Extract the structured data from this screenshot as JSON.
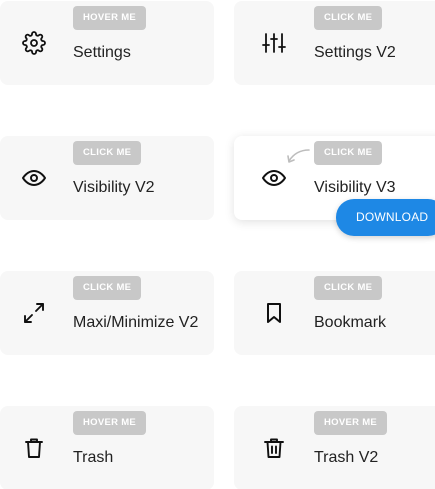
{
  "cards": [
    {
      "badge": "HOVER ME",
      "label": "Settings",
      "icon": "gear-icon"
    },
    {
      "badge": "CLICK ME",
      "label": "Settings V2",
      "icon": "sliders-icon"
    },
    {
      "badge": "CLICK ME",
      "label": "Visibility V2",
      "icon": "eye-icon"
    },
    {
      "badge": "CLICK ME",
      "label": "Visibility V3",
      "icon": "eye-icon"
    },
    {
      "badge": "CLICK ME",
      "label": "Maxi/Minimize V2",
      "icon": "expand-arrows-icon"
    },
    {
      "badge": "CLICK ME",
      "label": "Bookmark",
      "icon": "bookmark-icon"
    },
    {
      "badge": "HOVER ME",
      "label": "Trash",
      "icon": "trash-icon"
    },
    {
      "badge": "HOVER ME",
      "label": "Trash V2",
      "icon": "trash-v2-icon"
    }
  ],
  "download_button": {
    "label": "DOWNLOAD"
  },
  "colors": {
    "card_bg": "#f7f7f7",
    "badge_bg": "#c8c8c8",
    "accent": "#1e88e5",
    "text": "#222222"
  }
}
